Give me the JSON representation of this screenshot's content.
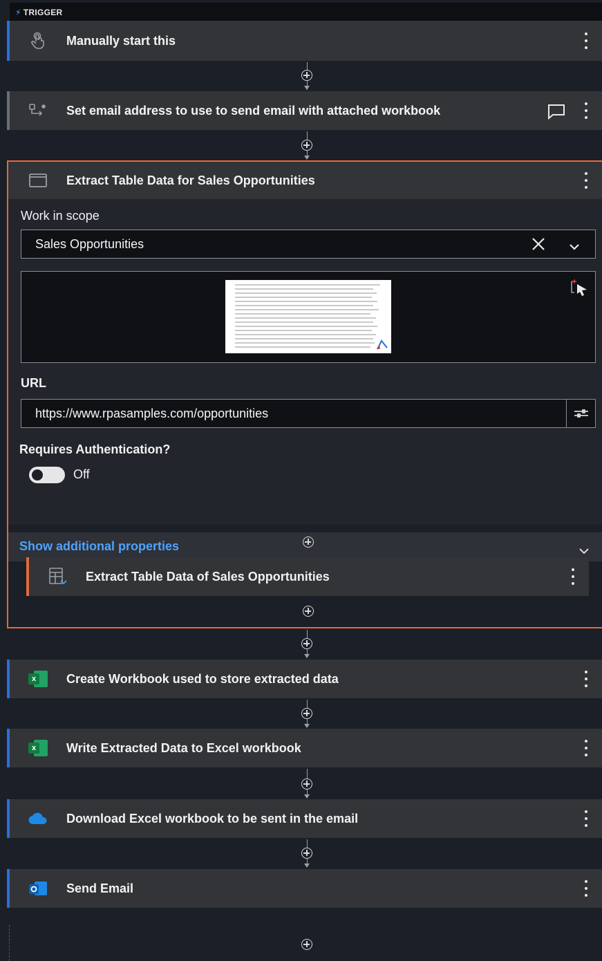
{
  "trigger_label": "TRIGGER",
  "steps": {
    "manual_start": "Manually start this",
    "set_email": "Set email address to use to send email with attached workbook",
    "extract_scope": "Extract Table Data for Sales Opportunities",
    "create_workbook": "Create Workbook used to store extracted data",
    "write_data": "Write Extracted Data to Excel workbook",
    "download_workbook": "Download Excel workbook to be sent in the email",
    "send_email": "Send Email"
  },
  "scope_panel": {
    "work_in_scope_label": "Work in scope",
    "work_in_scope_value": "Sales Opportunities",
    "url_label": "URL",
    "url_value": "https://www.rpasamples.com/opportunities",
    "auth_label": "Requires Authentication?",
    "auth_state": "Off",
    "show_more": "Show additional properties",
    "nested_step": "Extract Table Data of Sales Opportunities"
  },
  "icons": {
    "manual": "hand-touch-icon",
    "assign": "variable-assign-icon",
    "scope": "browser-window-icon",
    "extract": "table-extract-icon",
    "excel": "excel-icon",
    "onedrive": "cloud-icon",
    "outlook": "outlook-icon"
  },
  "colors": {
    "accent_blue": "#2a6fdb",
    "scope_orange": "#e56a3a",
    "link_blue": "#4ea3ff"
  }
}
